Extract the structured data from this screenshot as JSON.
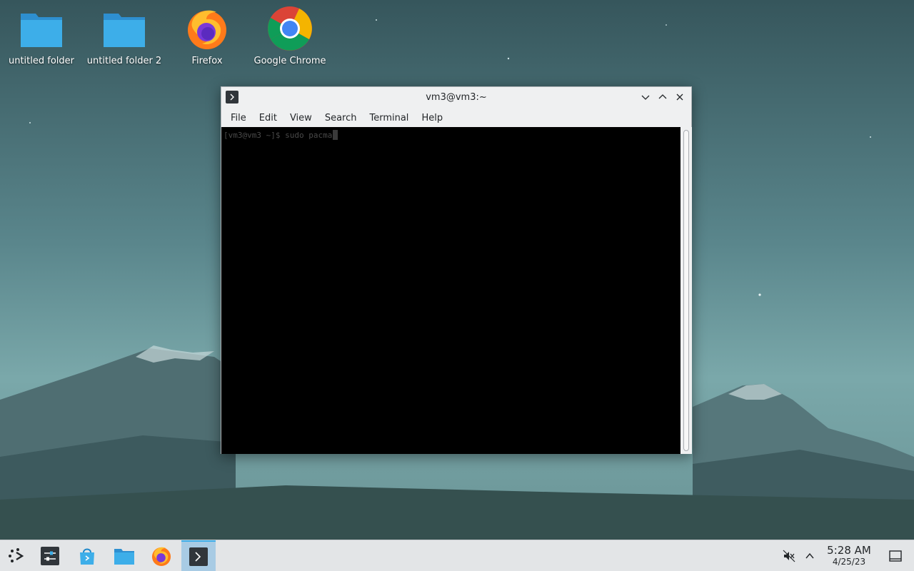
{
  "desktop": {
    "icons": [
      {
        "label": "untitled folder",
        "icon": "folder-icon"
      },
      {
        "label": "untitled folder 2",
        "icon": "folder-icon"
      },
      {
        "label": "Firefox",
        "icon": "firefox-icon"
      },
      {
        "label": "Google Chrome",
        "icon": "chrome-icon"
      }
    ]
  },
  "window": {
    "title": "vm3@vm3:~",
    "menu": [
      "File",
      "Edit",
      "View",
      "Search",
      "Terminal",
      "Help"
    ],
    "terminal": {
      "prompt": "[vm3@vm3 ~]$ ",
      "command": "sudo pacma"
    }
  },
  "taskbar": {
    "items": [
      {
        "name": "app-launcher",
        "icon": "app-launcher-icon"
      },
      {
        "name": "system-settings",
        "icon": "settings-icon"
      },
      {
        "name": "discover",
        "icon": "store-icon"
      },
      {
        "name": "file-manager",
        "icon": "folder-icon"
      },
      {
        "name": "firefox",
        "icon": "firefox-icon"
      },
      {
        "name": "konsole",
        "icon": "terminal-icon",
        "active": true
      }
    ],
    "clock": {
      "time": "5:28 AM",
      "date": "4/25/23"
    }
  },
  "colors": {
    "accent": "#3daee9",
    "folder": "#3a9bd9",
    "taskbar": "#e3e5e7"
  }
}
